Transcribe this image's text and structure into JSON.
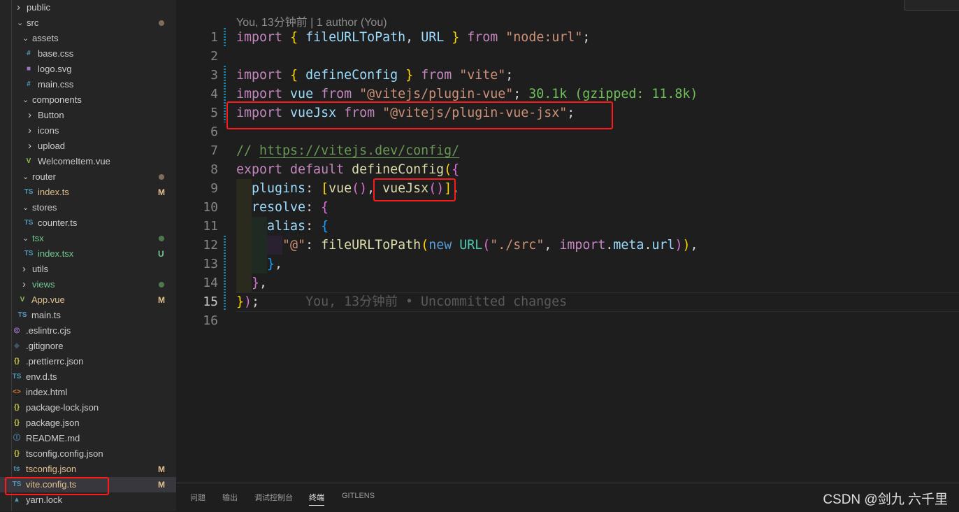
{
  "explorer": {
    "items": [
      {
        "label": "public",
        "kind": "folder",
        "open": false,
        "level": 0
      },
      {
        "label": "src",
        "kind": "folder",
        "open": true,
        "level": 0,
        "dot": "#7f6f5a"
      },
      {
        "label": "assets",
        "kind": "folder",
        "open": true,
        "level": 1
      },
      {
        "label": "base.css",
        "kind": "file",
        "icon": "#",
        "iconColor": "#519aba",
        "level": 2
      },
      {
        "label": "logo.svg",
        "kind": "file",
        "icon": "■",
        "iconColor": "#a074c4",
        "level": 2
      },
      {
        "label": "main.css",
        "kind": "file",
        "icon": "#",
        "iconColor": "#519aba",
        "level": 2
      },
      {
        "label": "components",
        "kind": "folder",
        "open": true,
        "level": 1
      },
      {
        "label": "Button",
        "kind": "folder",
        "open": false,
        "level": 2
      },
      {
        "label": "icons",
        "kind": "folder",
        "open": false,
        "level": 2
      },
      {
        "label": "upload",
        "kind": "folder",
        "open": false,
        "level": 2
      },
      {
        "label": "WelcomeItem.vue",
        "kind": "file",
        "icon": "V",
        "iconColor": "#8dc149",
        "level": 2
      },
      {
        "label": "router",
        "kind": "folder",
        "open": true,
        "level": 1,
        "dot": "#7f6f5a"
      },
      {
        "label": "index.ts",
        "kind": "file",
        "icon": "TS",
        "iconColor": "#519aba",
        "level": 2,
        "badge": "M",
        "color": "#e2c08d"
      },
      {
        "label": "stores",
        "kind": "folder",
        "open": true,
        "level": 1
      },
      {
        "label": "counter.ts",
        "kind": "file",
        "icon": "TS",
        "iconColor": "#519aba",
        "level": 2
      },
      {
        "label": "tsx",
        "kind": "folder",
        "open": true,
        "level": 1,
        "dot": "#4b7a51",
        "color": "#73c991"
      },
      {
        "label": "index.tsx",
        "kind": "file",
        "icon": "TS",
        "iconColor": "#519aba",
        "level": 2,
        "badge": "U",
        "color": "#73c991"
      },
      {
        "label": "utils",
        "kind": "folder",
        "open": false,
        "level": 1
      },
      {
        "label": "views",
        "kind": "folder",
        "open": false,
        "level": 1,
        "dot": "#4b7a51",
        "color": "#73c991"
      },
      {
        "label": "App.vue",
        "kind": "file",
        "icon": "V",
        "iconColor": "#8dc149",
        "level": 1,
        "badge": "M",
        "color": "#e2c08d"
      },
      {
        "label": "main.ts",
        "kind": "file",
        "icon": "TS",
        "iconColor": "#519aba",
        "level": 1
      },
      {
        "label": ".eslintrc.cjs",
        "kind": "file",
        "icon": "◎",
        "iconColor": "#a074c4",
        "level": 0
      },
      {
        "label": ".gitignore",
        "kind": "file",
        "icon": "◆",
        "iconColor": "#41535b",
        "level": 0
      },
      {
        "label": ".prettierrc.json",
        "kind": "file",
        "icon": "{}",
        "iconColor": "#cbcb41",
        "level": 0
      },
      {
        "label": "env.d.ts",
        "kind": "file",
        "icon": "TS",
        "iconColor": "#519aba",
        "level": 0
      },
      {
        "label": "index.html",
        "kind": "file",
        "icon": "<>",
        "iconColor": "#e37933",
        "level": 0
      },
      {
        "label": "package-lock.json",
        "kind": "file",
        "icon": "{}",
        "iconColor": "#cbcb41",
        "level": 0
      },
      {
        "label": "package.json",
        "kind": "file",
        "icon": "{}",
        "iconColor": "#cbcb41",
        "level": 0
      },
      {
        "label": "README.md",
        "kind": "file",
        "icon": "ⓘ",
        "iconColor": "#519aba",
        "level": 0
      },
      {
        "label": "tsconfig.config.json",
        "kind": "file",
        "icon": "{}",
        "iconColor": "#cbcb41",
        "level": 0
      },
      {
        "label": "tsconfig.json",
        "kind": "file",
        "icon": "ts",
        "iconColor": "#519aba",
        "level": 0,
        "badge": "M",
        "color": "#e2c08d"
      },
      {
        "label": "vite.config.ts",
        "kind": "file",
        "icon": "TS",
        "iconColor": "#519aba",
        "level": 0,
        "badge": "M",
        "color": "#e2c08d",
        "selected": true
      },
      {
        "label": "yarn.lock",
        "kind": "file",
        "icon": "▲",
        "iconColor": "#519aba",
        "level": 0
      }
    ]
  },
  "editor": {
    "codelens": "You, 13分钟前 | 1 author (You)",
    "active_line": 15,
    "lines": [
      [
        [
          "import",
          "kw"
        ],
        [
          " ",
          "plain"
        ],
        [
          "{",
          "br1"
        ],
        [
          " fileURLToPath",
          "var"
        ],
        [
          ", ",
          "plain"
        ],
        [
          "URL",
          "var"
        ],
        [
          " ",
          "plain"
        ],
        [
          "}",
          "br1"
        ],
        [
          " from ",
          "kw"
        ],
        [
          "\"node:url\"",
          "str"
        ],
        [
          ";",
          "plain"
        ]
      ],
      [],
      [
        [
          "import",
          "kw"
        ],
        [
          " ",
          "plain"
        ],
        [
          "{",
          "br1"
        ],
        [
          " defineConfig ",
          "var"
        ],
        [
          "}",
          "br1"
        ],
        [
          " from ",
          "kw"
        ],
        [
          "\"vite\"",
          "str"
        ],
        [
          ";",
          "plain"
        ]
      ],
      [
        [
          "import",
          "kw"
        ],
        [
          " vue ",
          "var"
        ],
        [
          "from ",
          "kw"
        ],
        [
          "\"@vitejs/plugin-vue\"",
          "str"
        ],
        [
          ";",
          "plain"
        ],
        [
          " 30.1k (gzipped: 11.8k)",
          "hint"
        ]
      ],
      [
        [
          "import",
          "kw"
        ],
        [
          " vueJsx ",
          "var"
        ],
        [
          "from ",
          "kw"
        ],
        [
          "\"@vitejs/plugin-vue-jsx\"",
          "str"
        ],
        [
          ";",
          "plain"
        ]
      ],
      [],
      [
        [
          "// ",
          "cm"
        ],
        [
          "https://vitejs.dev/config/",
          "url"
        ]
      ],
      [
        [
          "export default ",
          "kw"
        ],
        [
          "defineConfig",
          "fn"
        ],
        [
          "(",
          "br1"
        ],
        [
          "{",
          "br2"
        ]
      ],
      [
        [
          "  plugins",
          "var"
        ],
        [
          ": ",
          "plain"
        ],
        [
          "[",
          "br1"
        ],
        [
          "vue",
          "fn"
        ],
        [
          "()",
          "br2"
        ],
        [
          ", ",
          "plain"
        ],
        [
          "vueJsx",
          "fn"
        ],
        [
          "()",
          "br2"
        ],
        [
          "]",
          "br1"
        ],
        [
          ",",
          "plain"
        ]
      ],
      [
        [
          "  resolve",
          "var"
        ],
        [
          ": ",
          "plain"
        ],
        [
          "{",
          "br2"
        ]
      ],
      [
        [
          "    alias",
          "var"
        ],
        [
          ": ",
          "plain"
        ],
        [
          "{",
          "br3"
        ]
      ],
      [
        [
          "      ",
          "plain"
        ],
        [
          "\"@\"",
          "str"
        ],
        [
          ": ",
          "plain"
        ],
        [
          "fileURLToPath",
          "fn"
        ],
        [
          "(",
          "br1"
        ],
        [
          "new ",
          "kw2"
        ],
        [
          "URL",
          "cls"
        ],
        [
          "(",
          "br2"
        ],
        [
          "\"./src\"",
          "str"
        ],
        [
          ", ",
          "plain"
        ],
        [
          "import",
          "kw"
        ],
        [
          ".",
          "plain"
        ],
        [
          "meta",
          "var"
        ],
        [
          ".",
          "plain"
        ],
        [
          "url",
          "var"
        ],
        [
          ")",
          "br2"
        ],
        [
          ")",
          "br1"
        ],
        [
          ",",
          "plain"
        ]
      ],
      [
        [
          "    ",
          "plain"
        ],
        [
          "}",
          "br3"
        ],
        [
          ",",
          "plain"
        ]
      ],
      [
        [
          "  ",
          "plain"
        ],
        [
          "}",
          "br2"
        ],
        [
          ",",
          "plain"
        ]
      ],
      [
        [
          "}",
          "br1"
        ],
        [
          ")",
          "br2"
        ],
        [
          ";",
          "plain"
        ],
        [
          "      You, 13分钟前 • Uncommitted changes",
          "blame"
        ]
      ],
      []
    ]
  },
  "panel": {
    "tabs": [
      {
        "label": "问题",
        "active": false
      },
      {
        "label": "输出",
        "active": false
      },
      {
        "label": "调试控制台",
        "active": false
      },
      {
        "label": "终端",
        "active": true
      },
      {
        "label": "GITLENS",
        "active": false
      }
    ]
  },
  "watermark": "CSDN @剑九 六千里",
  "colors": {
    "highlight_box": "#ff1a1a",
    "selection": "#37373d"
  }
}
